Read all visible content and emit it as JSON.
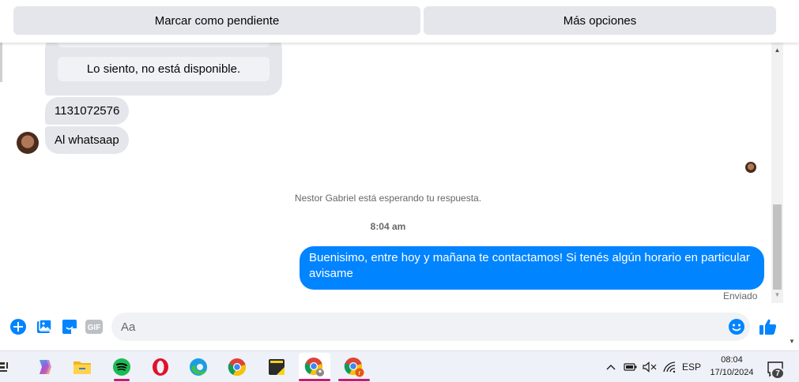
{
  "top_actions": {
    "pending_label": "Marcar como pendiente",
    "more_label": "Más opciones"
  },
  "quick_replies": {
    "unavailable_label": "Lo siento, no está disponible."
  },
  "messages": {
    "incoming": [
      {
        "text": "1131072576"
      },
      {
        "text": "Al whatsaap"
      }
    ],
    "waiting_notice": "Nestor Gabriel está esperando tu respuesta.",
    "time_separator": "8:04 am",
    "outgoing": {
      "text": "Buenisimo, entre hoy y mañana te contactamos! Si tenés algún horario en particular avisame",
      "status": "Enviado"
    }
  },
  "composer": {
    "placeholder": "Aa",
    "icons": [
      "plus-icon",
      "image-icon",
      "sticker-icon",
      "gif-icon",
      "emoji-icon",
      "like-icon"
    ],
    "gif_label": "GIF"
  },
  "taskbar": {
    "apps": [
      "copilot-icon",
      "file-explorer-icon",
      "spotify-icon",
      "opera-icon",
      "edge-icon",
      "chrome-icon",
      "sticky-notes-icon",
      "chrome-profile-icon",
      "chrome-profile-r-icon"
    ],
    "language": "ESP",
    "time": "08:04",
    "date": "17/10/2024",
    "notification_count": "7",
    "chrome_profile_letter": "r"
  },
  "colors": {
    "accent": "#0084ff",
    "bubble_gray": "#e4e6eb",
    "spotify_green": "#1db954",
    "opera_red": "#e0112b",
    "taskbar_indicator": "#c71b6e"
  }
}
